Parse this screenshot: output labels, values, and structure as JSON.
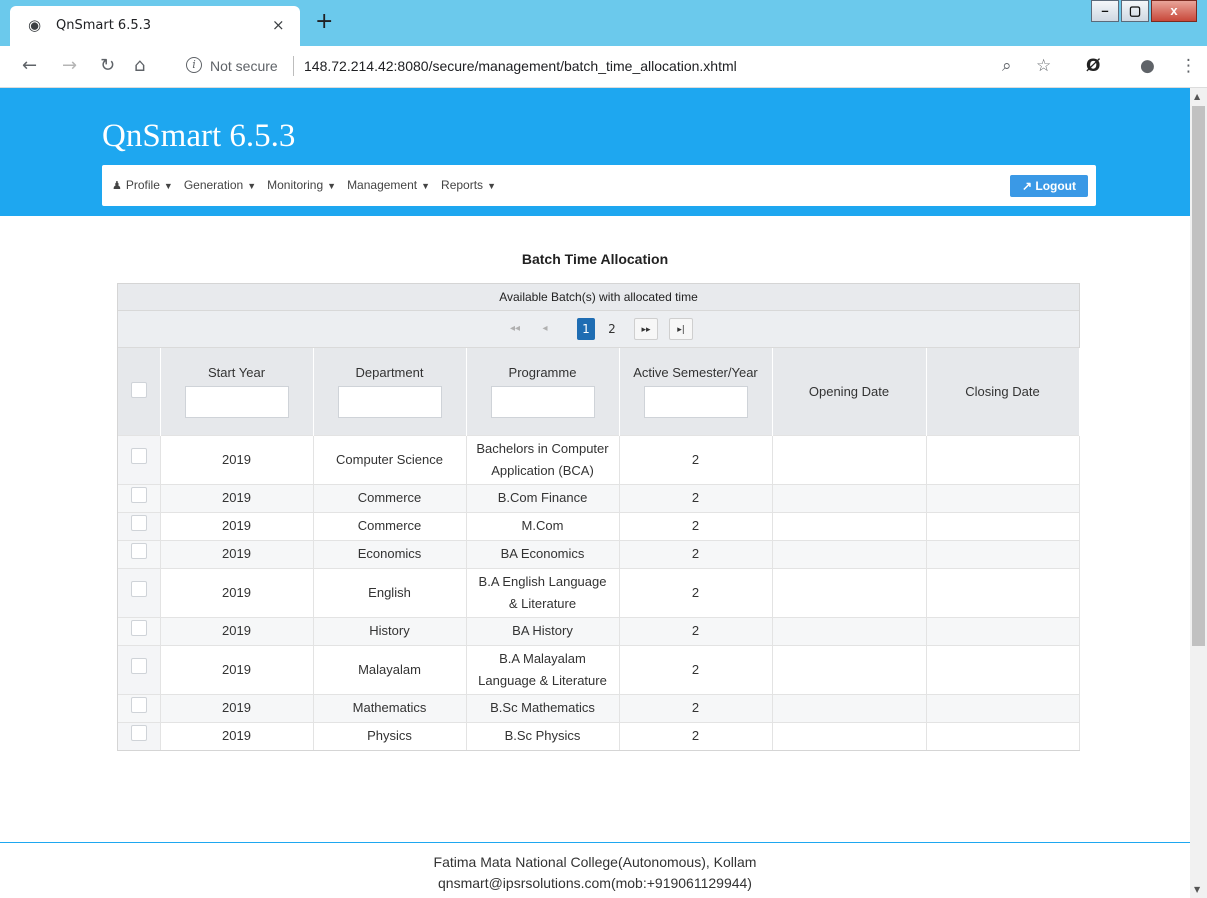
{
  "browser": {
    "tab_title": "QnSmart 6.5.3",
    "tab_close": "×",
    "new_tab": "+",
    "not_secure": "Not secure",
    "url": "148.72.214.42:8080/secure/management/batch_time_allocation.xhtml",
    "window_buttons": {
      "minimize": "–",
      "restore": "▢",
      "close": "x"
    }
  },
  "app": {
    "title": "QnSmart 6.5.3",
    "nav": [
      {
        "label": "Profile"
      },
      {
        "label": "Generation"
      },
      {
        "label": "Monitoring"
      },
      {
        "label": "Management"
      },
      {
        "label": "Reports"
      }
    ],
    "logout_label": "Logout"
  },
  "page": {
    "title": "Batch Time Allocation",
    "grid_caption": "Available Batch(s) with allocated time",
    "paginator": {
      "pages": [
        "1",
        "2"
      ],
      "current": "1"
    },
    "columns": {
      "start_year": "Start Year",
      "department": "Department",
      "programme": "Programme",
      "active_sem": "Active Semester/Year",
      "opening_date": "Opening Date",
      "closing_date": "Closing Date"
    },
    "rows": [
      {
        "start_year": "2019",
        "department": "Computer Science",
        "programme": "Bachelors in Computer Application (BCA)",
        "active_sem": "2",
        "opening_date": "",
        "closing_date": ""
      },
      {
        "start_year": "2019",
        "department": "Commerce",
        "programme": "B.Com Finance",
        "active_sem": "2",
        "opening_date": "",
        "closing_date": ""
      },
      {
        "start_year": "2019",
        "department": "Commerce",
        "programme": "M.Com",
        "active_sem": "2",
        "opening_date": "",
        "closing_date": ""
      },
      {
        "start_year": "2019",
        "department": "Economics",
        "programme": "BA Economics",
        "active_sem": "2",
        "opening_date": "",
        "closing_date": ""
      },
      {
        "start_year": "2019",
        "department": "English",
        "programme": "B.A English Language & Literature",
        "active_sem": "2",
        "opening_date": "",
        "closing_date": ""
      },
      {
        "start_year": "2019",
        "department": "History",
        "programme": "BA History",
        "active_sem": "2",
        "opening_date": "",
        "closing_date": ""
      },
      {
        "start_year": "2019",
        "department": "Malayalam",
        "programme": "B.A Malayalam Language & Literature",
        "active_sem": "2",
        "opening_date": "",
        "closing_date": ""
      },
      {
        "start_year": "2019",
        "department": "Mathematics",
        "programme": "B.Sc Mathematics",
        "active_sem": "2",
        "opening_date": "",
        "closing_date": ""
      },
      {
        "start_year": "2019",
        "department": "Physics",
        "programme": "B.Sc Physics",
        "active_sem": "2",
        "opening_date": "",
        "closing_date": ""
      }
    ]
  },
  "footer": {
    "line1": "Fatima Mata National College(Autonomous), Kollam",
    "line2": "qnsmart@ipsrsolutions.com(mob:+919061129944)"
  },
  "colors": {
    "header_blue": "#1ea7f0",
    "tabstrip": "#6bc9ec",
    "active_page": "#1f6db3",
    "logout": "#3a99e6"
  }
}
